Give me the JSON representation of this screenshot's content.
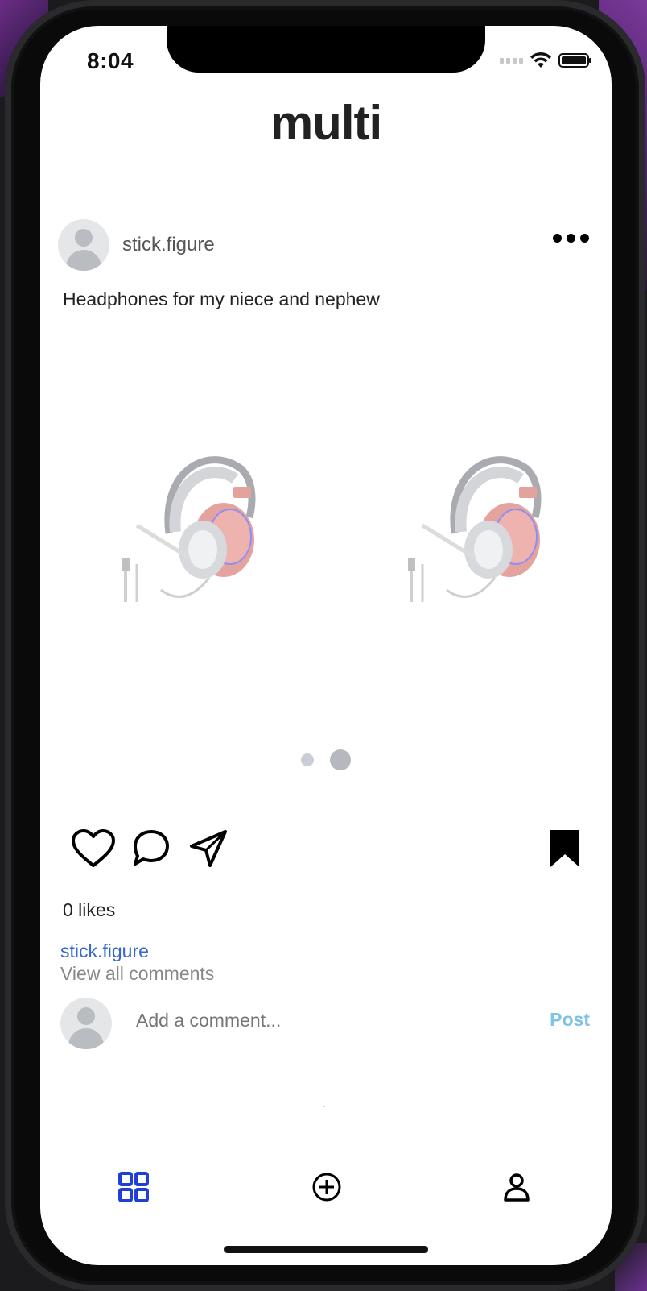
{
  "status_bar": {
    "time": "8:04"
  },
  "app": {
    "title": "multi"
  },
  "post": {
    "author": "stick.figure",
    "caption": "Headphones for my niece and nephew",
    "carousel": {
      "image_count": 2,
      "active_index": 1
    },
    "likes_text": "0 likes",
    "author_link": "stick.figure",
    "view_comments": "View all comments"
  },
  "comment": {
    "placeholder": "Add a comment...",
    "post_label": "Post"
  },
  "tabs": [
    {
      "icon": "grid-icon",
      "active": true
    },
    {
      "icon": "add-circle-icon",
      "active": false
    },
    {
      "icon": "profile-icon",
      "active": false
    }
  ],
  "colors": {
    "link": "#3568c9",
    "post_button": "#7ec3e6",
    "active_tab": "#1f3fd6"
  }
}
